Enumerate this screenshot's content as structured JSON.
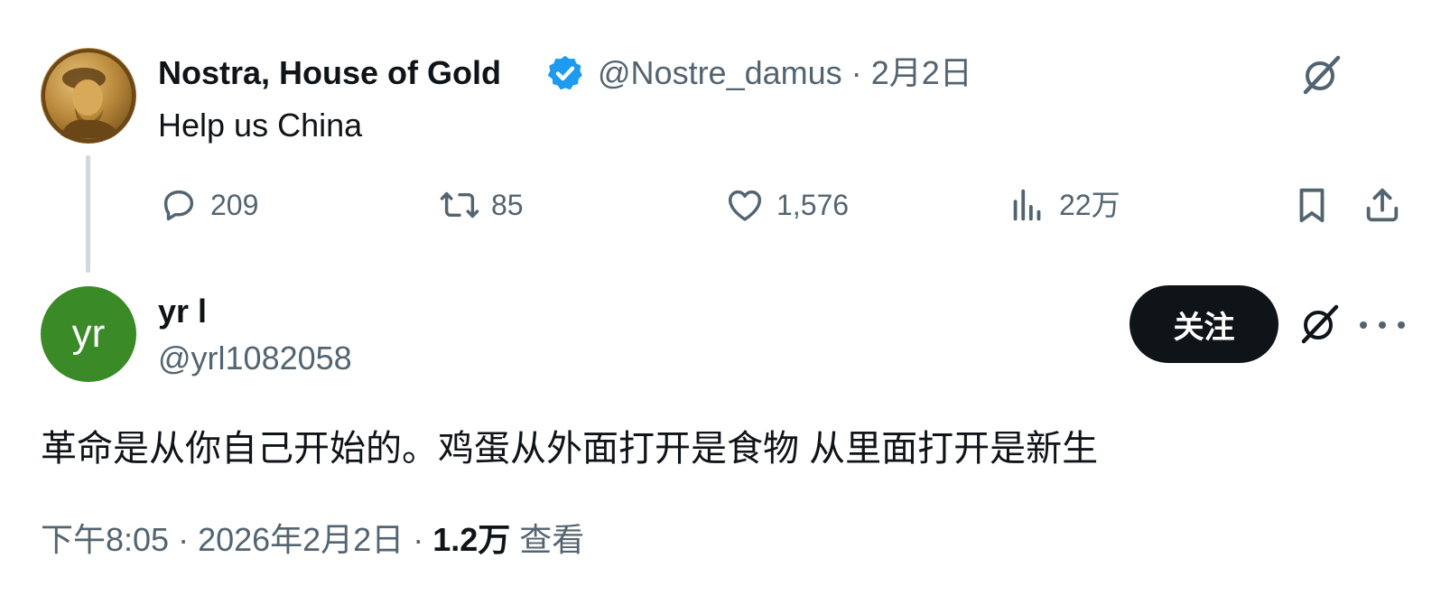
{
  "parent_tweet": {
    "author_name": "Nostra, House of Gold",
    "handle": "@Nostre_damus",
    "separator": "·",
    "date": "2月2日",
    "text": "Help us China",
    "verified": true,
    "stats": {
      "replies": "209",
      "retweets": "85",
      "likes": "1,576",
      "views": "22万"
    }
  },
  "reply_tweet": {
    "avatar_initials": "yr",
    "avatar_color": "#3b8a28",
    "author_name": "yr l",
    "handle": "@yrl1082058",
    "follow_label": "关注",
    "text": "革命是从你自己开始的。鸡蛋从外面打开是食物 从里面打开是新生",
    "footer": {
      "time": "下午8:05",
      "sep1": "·",
      "date": "2026年2月2日",
      "sep2": "·",
      "views_count": "1.2万",
      "views_label": "查看"
    }
  },
  "colors": {
    "text_primary": "#0f1419",
    "text_secondary": "#536471",
    "verified_blue": "#1d9bf0",
    "thread_line": "#cfd9de",
    "follow_bg": "#0f1419"
  },
  "icons": [
    "grok-icon",
    "verified-badge-icon",
    "reply-icon",
    "retweet-icon",
    "like-icon",
    "views-icon",
    "bookmark-icon",
    "share-icon",
    "more-icon"
  ]
}
